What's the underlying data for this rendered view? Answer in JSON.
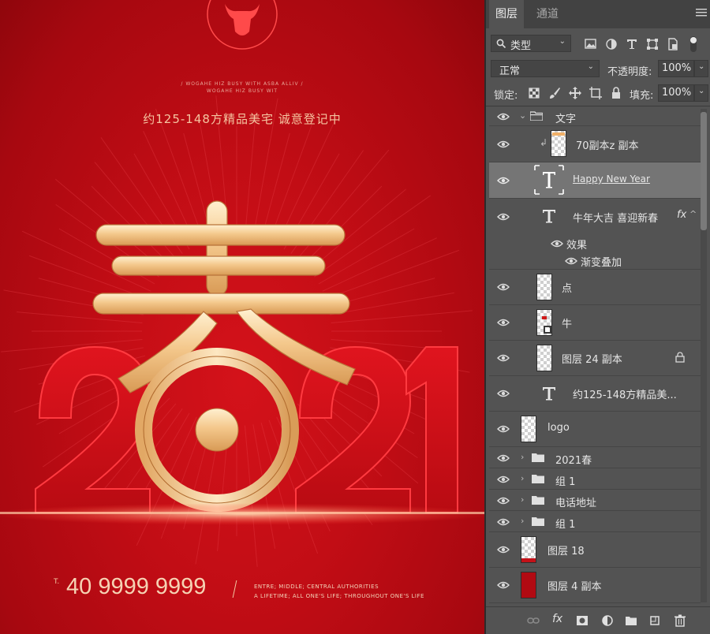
{
  "poster": {
    "top_text_line1": "/ WOGAHE HIZ BUSY WITH ASBA ALLIV /",
    "top_text_line2": "WOGAHE HIZ BUSY WIT",
    "subtitle": "约125-148方精品美宅  诚意登记中",
    "phone_prefix": "T.",
    "phone": "40 9999 9999",
    "slogan_line1": "ENTRE; MIDDLE; CENTRAL AUTHORITIES",
    "slogan_line2": "A LIFETIME; ALL ONE'S LIFE; THROUGHOUT ONE'S LIFE",
    "year_digits": [
      "2",
      "0",
      "2",
      "1"
    ]
  },
  "panel": {
    "tabs": [
      "图层",
      "通道"
    ],
    "filter_label": "类型",
    "blend_mode": "正常",
    "opacity_label": "不透明度:",
    "opacity_value": "100%",
    "lock_label": "锁定:",
    "fill_label": "填充:",
    "fill_value": "100%",
    "layers": [
      {
        "name": "文字",
        "kind": "group-open"
      },
      {
        "name": "70副本z 副本",
        "kind": "pixel-clipped"
      },
      {
        "name": "Happy New Year",
        "kind": "text-selected"
      },
      {
        "name": "牛年大吉  喜迎新春",
        "kind": "text-fx",
        "fx": "fx"
      },
      {
        "name": "效果",
        "kind": "effects"
      },
      {
        "name": "渐变叠加",
        "kind": "effect-item"
      },
      {
        "name": "点",
        "kind": "pixel"
      },
      {
        "name": "牛",
        "kind": "smart"
      },
      {
        "name": "图层 24 副本",
        "kind": "pixel-locked"
      },
      {
        "name": "约125-148方精品美...",
        "kind": "text"
      },
      {
        "name": "logo",
        "kind": "pixel"
      },
      {
        "name": "2021春",
        "kind": "group"
      },
      {
        "name": "组 1",
        "kind": "group"
      },
      {
        "name": "电话地址",
        "kind": "group"
      },
      {
        "name": "组 1",
        "kind": "group"
      },
      {
        "name": "图层 18",
        "kind": "pixel-redbar"
      },
      {
        "name": "图层 4 副本",
        "kind": "pixel-red"
      }
    ]
  },
  "colors": {
    "poster_red": "#c20d15",
    "gold": "#f3c98f",
    "panel_bg": "#535353",
    "selected_row": "#757575"
  }
}
